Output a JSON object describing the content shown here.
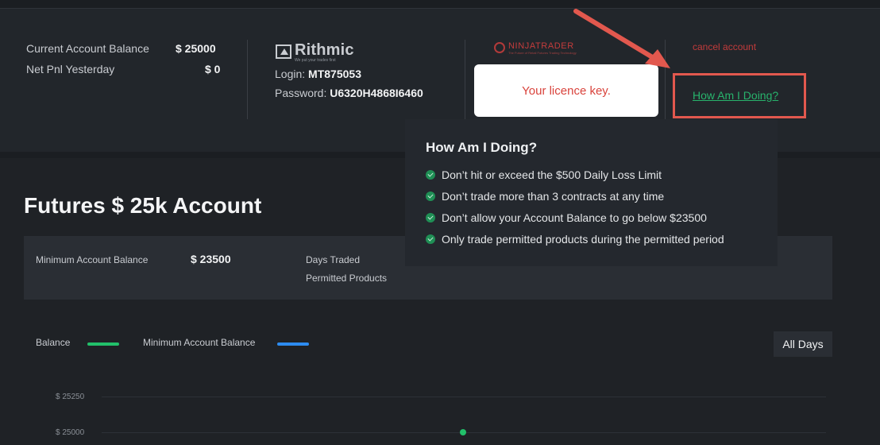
{
  "header": {
    "balances": [
      {
        "label": "Current Account Balance",
        "value": "$ 25000"
      },
      {
        "label": "Net Pnl Yesterday",
        "value": "$ 0"
      }
    ],
    "rithmic": {
      "logo_text": "Rithmic",
      "logo_tagline": "We put your trades first",
      "login_label": "Login:",
      "login_value": "MT875053",
      "password_label": "Password:",
      "password_value": "U6320H4868I6460"
    },
    "ninjatrader": {
      "logo_text": "NINJATRADER",
      "logo_tagline": "The Future of Retail Futures Trading Technology"
    },
    "cancel_label": "cancel account",
    "how_label": "How Am I Doing?"
  },
  "annotation": {
    "licence_text": "Your licence key.",
    "accent_color": "#e2584e"
  },
  "tooltip": {
    "title": "How Am I Doing?",
    "rules": [
      "Don’t hit or exceed the $500 Daily Loss Limit",
      "Don’t trade more than 3 contracts at any time",
      "Don’t allow your Account Balance to go below $23500",
      "Only trade permitted products during the permitted period"
    ]
  },
  "main": {
    "title": "Futures $ 25k Account",
    "info": {
      "min_balance_label": "Minimum Account Balance",
      "min_balance_value": "$ 23500",
      "days_traded_label": "Days Traded",
      "permitted_products_label": "Permitted Products"
    }
  },
  "chart_data": {
    "type": "line",
    "series": [
      {
        "name": "Balance",
        "color": "#22c06a",
        "x": [
          0
        ],
        "y": [
          25000
        ]
      },
      {
        "name": "Minimum Account Balance",
        "color": "#2d8cf0",
        "x": [],
        "y": []
      }
    ],
    "y_ticks": [
      "$ 25250",
      "$ 25000"
    ],
    "range_button": "All Days",
    "grid": true,
    "legend": "top-left"
  }
}
